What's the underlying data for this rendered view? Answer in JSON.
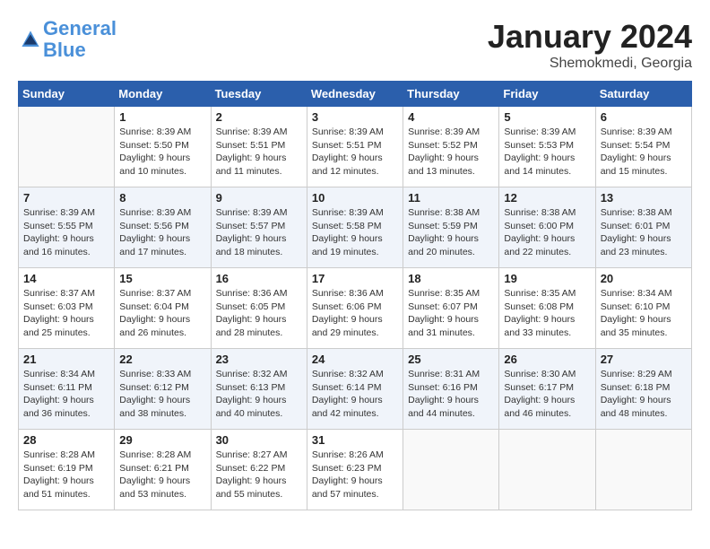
{
  "logo": {
    "line1": "General",
    "line2": "Blue"
  },
  "title": "January 2024",
  "location": "Shemokmedi, Georgia",
  "days_of_week": [
    "Sunday",
    "Monday",
    "Tuesday",
    "Wednesday",
    "Thursday",
    "Friday",
    "Saturday"
  ],
  "weeks": [
    [
      {
        "day": "",
        "info": ""
      },
      {
        "day": "1",
        "info": "Sunrise: 8:39 AM\nSunset: 5:50 PM\nDaylight: 9 hours\nand 10 minutes."
      },
      {
        "day": "2",
        "info": "Sunrise: 8:39 AM\nSunset: 5:51 PM\nDaylight: 9 hours\nand 11 minutes."
      },
      {
        "day": "3",
        "info": "Sunrise: 8:39 AM\nSunset: 5:51 PM\nDaylight: 9 hours\nand 12 minutes."
      },
      {
        "day": "4",
        "info": "Sunrise: 8:39 AM\nSunset: 5:52 PM\nDaylight: 9 hours\nand 13 minutes."
      },
      {
        "day": "5",
        "info": "Sunrise: 8:39 AM\nSunset: 5:53 PM\nDaylight: 9 hours\nand 14 minutes."
      },
      {
        "day": "6",
        "info": "Sunrise: 8:39 AM\nSunset: 5:54 PM\nDaylight: 9 hours\nand 15 minutes."
      }
    ],
    [
      {
        "day": "7",
        "info": "Sunrise: 8:39 AM\nSunset: 5:55 PM\nDaylight: 9 hours\nand 16 minutes."
      },
      {
        "day": "8",
        "info": "Sunrise: 8:39 AM\nSunset: 5:56 PM\nDaylight: 9 hours\nand 17 minutes."
      },
      {
        "day": "9",
        "info": "Sunrise: 8:39 AM\nSunset: 5:57 PM\nDaylight: 9 hours\nand 18 minutes."
      },
      {
        "day": "10",
        "info": "Sunrise: 8:39 AM\nSunset: 5:58 PM\nDaylight: 9 hours\nand 19 minutes."
      },
      {
        "day": "11",
        "info": "Sunrise: 8:38 AM\nSunset: 5:59 PM\nDaylight: 9 hours\nand 20 minutes."
      },
      {
        "day": "12",
        "info": "Sunrise: 8:38 AM\nSunset: 6:00 PM\nDaylight: 9 hours\nand 22 minutes."
      },
      {
        "day": "13",
        "info": "Sunrise: 8:38 AM\nSunset: 6:01 PM\nDaylight: 9 hours\nand 23 minutes."
      }
    ],
    [
      {
        "day": "14",
        "info": "Sunrise: 8:37 AM\nSunset: 6:03 PM\nDaylight: 9 hours\nand 25 minutes."
      },
      {
        "day": "15",
        "info": "Sunrise: 8:37 AM\nSunset: 6:04 PM\nDaylight: 9 hours\nand 26 minutes."
      },
      {
        "day": "16",
        "info": "Sunrise: 8:36 AM\nSunset: 6:05 PM\nDaylight: 9 hours\nand 28 minutes."
      },
      {
        "day": "17",
        "info": "Sunrise: 8:36 AM\nSunset: 6:06 PM\nDaylight: 9 hours\nand 29 minutes."
      },
      {
        "day": "18",
        "info": "Sunrise: 8:35 AM\nSunset: 6:07 PM\nDaylight: 9 hours\nand 31 minutes."
      },
      {
        "day": "19",
        "info": "Sunrise: 8:35 AM\nSunset: 6:08 PM\nDaylight: 9 hours\nand 33 minutes."
      },
      {
        "day": "20",
        "info": "Sunrise: 8:34 AM\nSunset: 6:10 PM\nDaylight: 9 hours\nand 35 minutes."
      }
    ],
    [
      {
        "day": "21",
        "info": "Sunrise: 8:34 AM\nSunset: 6:11 PM\nDaylight: 9 hours\nand 36 minutes."
      },
      {
        "day": "22",
        "info": "Sunrise: 8:33 AM\nSunset: 6:12 PM\nDaylight: 9 hours\nand 38 minutes."
      },
      {
        "day": "23",
        "info": "Sunrise: 8:32 AM\nSunset: 6:13 PM\nDaylight: 9 hours\nand 40 minutes."
      },
      {
        "day": "24",
        "info": "Sunrise: 8:32 AM\nSunset: 6:14 PM\nDaylight: 9 hours\nand 42 minutes."
      },
      {
        "day": "25",
        "info": "Sunrise: 8:31 AM\nSunset: 6:16 PM\nDaylight: 9 hours\nand 44 minutes."
      },
      {
        "day": "26",
        "info": "Sunrise: 8:30 AM\nSunset: 6:17 PM\nDaylight: 9 hours\nand 46 minutes."
      },
      {
        "day": "27",
        "info": "Sunrise: 8:29 AM\nSunset: 6:18 PM\nDaylight: 9 hours\nand 48 minutes."
      }
    ],
    [
      {
        "day": "28",
        "info": "Sunrise: 8:28 AM\nSunset: 6:19 PM\nDaylight: 9 hours\nand 51 minutes."
      },
      {
        "day": "29",
        "info": "Sunrise: 8:28 AM\nSunset: 6:21 PM\nDaylight: 9 hours\nand 53 minutes."
      },
      {
        "day": "30",
        "info": "Sunrise: 8:27 AM\nSunset: 6:22 PM\nDaylight: 9 hours\nand 55 minutes."
      },
      {
        "day": "31",
        "info": "Sunrise: 8:26 AM\nSunset: 6:23 PM\nDaylight: 9 hours\nand 57 minutes."
      },
      {
        "day": "",
        "info": ""
      },
      {
        "day": "",
        "info": ""
      },
      {
        "day": "",
        "info": ""
      }
    ]
  ]
}
